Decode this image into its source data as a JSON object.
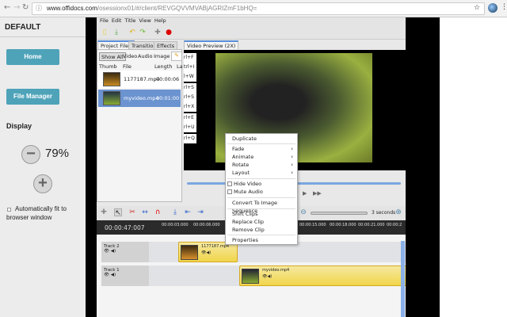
{
  "browser": {
    "url_host": "www.offidocs.com",
    "url_path": "/osessionx01/#/client/REVGQVVMVABjAGRIZmF1bHQ=",
    "icons": [
      "back-icon",
      "forward-icon",
      "reload-icon",
      "info-icon",
      "star-icon",
      "profile-icon",
      "more-icon"
    ]
  },
  "sidebar": {
    "title": "DEFAULT",
    "home": "Home",
    "file_manager": "File Manager",
    "display_label": "Display",
    "zoom": "79%",
    "auto_fit": "Automatically fit to browser window",
    "auto_fit_checked": false,
    "accent": "#4ea3b9"
  },
  "app": {
    "menu": [
      "File",
      "Edit",
      "Title",
      "View",
      "Help"
    ],
    "left_tabs": [
      "Project Files",
      "Transitions",
      "Effects"
    ],
    "preview_tab": "Video Preview (2X)",
    "filters": [
      "Show All",
      "Video",
      "Audio",
      "Image"
    ],
    "columns": [
      "Thumb",
      "File",
      "Length",
      "La"
    ],
    "files": [
      {
        "name": "1177187.mp4",
        "length": "00:00:06",
        "selected": false
      },
      {
        "name": "myvideo.mp4",
        "length": "00:01:00",
        "selected": true
      }
    ],
    "shortcuts": [
      "rl+F",
      "trl+I",
      "l+W",
      "rl+S",
      "rl+S",
      "rl+X",
      "rl+E",
      "rl+U",
      "rl+Q"
    ],
    "context_menu": {
      "items": [
        {
          "label": "Duplicate"
        },
        {
          "sep": true
        },
        {
          "label": "Fade",
          "submenu": true
        },
        {
          "label": "Animate",
          "submenu": true
        },
        {
          "label": "Rotate",
          "submenu": true
        },
        {
          "label": "Layout",
          "submenu": true
        },
        {
          "sep": true
        },
        {
          "label": "Hide Video",
          "checkbox": true
        },
        {
          "label": "Mute Audio",
          "checkbox": true
        },
        {
          "sep": true
        },
        {
          "label": "Convert To Image Sequence"
        },
        {
          "sep": true
        },
        {
          "label": "Shift Clips"
        },
        {
          "label": "Replace Clip"
        },
        {
          "label": "Remove Clip"
        },
        {
          "sep": true
        },
        {
          "label": "Properties"
        }
      ]
    },
    "timeline": {
      "zoom_label": "3 seconds",
      "timecode": "00:00:47:007",
      "ticks": [
        "00:00:03.000",
        "00:00:06.000",
        "00:00:15.000",
        "00:00:18.000",
        "00:00:21.000",
        "00:00:2"
      ],
      "tracks": [
        {
          "name": "Track 2",
          "clip": "1177187.mp4"
        },
        {
          "name": "Track 1",
          "clip": "myvideo.mp4"
        }
      ]
    }
  }
}
